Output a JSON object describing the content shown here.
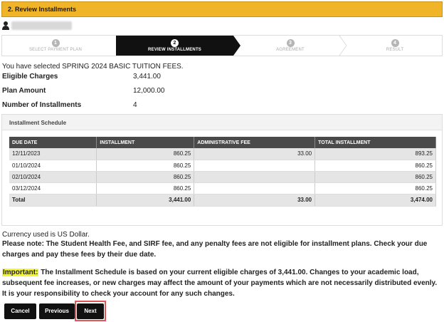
{
  "section": {
    "title": "2. Review Installments"
  },
  "stepper": {
    "steps": [
      {
        "num": "1",
        "label": "SELECT PAYMENT PLAN"
      },
      {
        "num": "2",
        "label": "REVIEW INSTALLMENTS"
      },
      {
        "num": "3",
        "label": "AGREEMENT"
      },
      {
        "num": "4",
        "label": "RESULT"
      }
    ]
  },
  "selection": {
    "text": "You have selected SPRING 2024 BASIC TUITION FEES."
  },
  "summary": {
    "eligible_label": "Eligible Charges",
    "eligible_value": "3,441.00",
    "plan_label": "Plan Amount",
    "plan_value": "12,000.00",
    "installments_label": "Number of Installments",
    "installments_value": "4"
  },
  "schedule": {
    "title": "Installment Schedule",
    "headers": [
      "DUE DATE",
      "INSTALLMENT",
      "ADMINISTRATIVE FEE",
      "TOTAL INSTALLMENT"
    ],
    "rows": [
      [
        "12/11/2023",
        "860.25",
        "33.00",
        "893.25"
      ],
      [
        "01/10/2024",
        "860.25",
        "",
        "860.25"
      ],
      [
        "02/10/2024",
        "860.25",
        "",
        "860.25"
      ],
      [
        "03/12/2024",
        "860.25",
        "",
        "860.25"
      ]
    ],
    "total": [
      "Total",
      "3,441.00",
      "33.00",
      "3,474.00"
    ]
  },
  "notes": {
    "currency": "Currency used is US Dollar.",
    "please_note": "Please note: The Student Health Fee, and SIRF fee, and any penalty fees are not eligible for installment plans. Check your due charges and pay these fees by their due date.",
    "important_label": "Important:",
    "important_text": " The Installment Schedule is based on your current eligible charges of 3,441.00.  Changes to your academic load, subsequent fee increases, or new charges may affect the amount of your payments which are not necessarily distributed evenly.  It is your responsibility to check your account for any such changes."
  },
  "buttons": {
    "cancel": "Cancel",
    "previous": "Previous",
    "next": "Next"
  }
}
